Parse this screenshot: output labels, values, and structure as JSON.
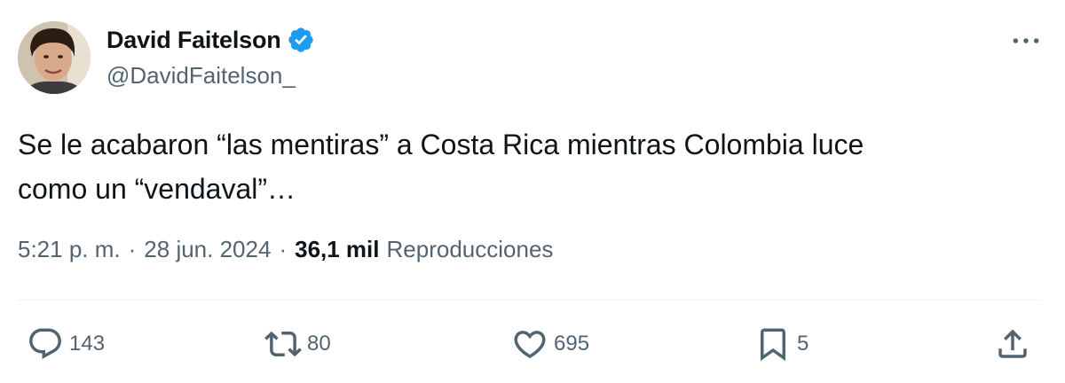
{
  "author": {
    "display_name": "David Faitelson",
    "handle": "@DavidFaitelson_",
    "verified": true,
    "avatar_icon": "person-avatar"
  },
  "tweet": {
    "text_line1": "Se le acabaron “las mentiras” a Costa Rica mientras Colombia luce",
    "text_line2": "como un “vendaval”…"
  },
  "meta": {
    "time": "5:21 p. m.",
    "separator": "·",
    "date": "28 jun. 2024",
    "views_count": "36,1 mil",
    "views_label": "Reproducciones"
  },
  "actions": {
    "replies": "143",
    "reposts": "80",
    "likes": "695",
    "bookmarks": "5"
  },
  "icons": {
    "more": "more-dots-icon",
    "verified": "verified-badge-icon",
    "reply": "reply-icon",
    "repost": "repost-icon",
    "like": "heart-icon",
    "bookmark": "bookmark-icon",
    "share": "share-icon"
  },
  "colors": {
    "verified": "#1d9bf0",
    "text_primary": "#0f1419",
    "text_secondary": "#536471",
    "divider": "#eff3f4"
  }
}
